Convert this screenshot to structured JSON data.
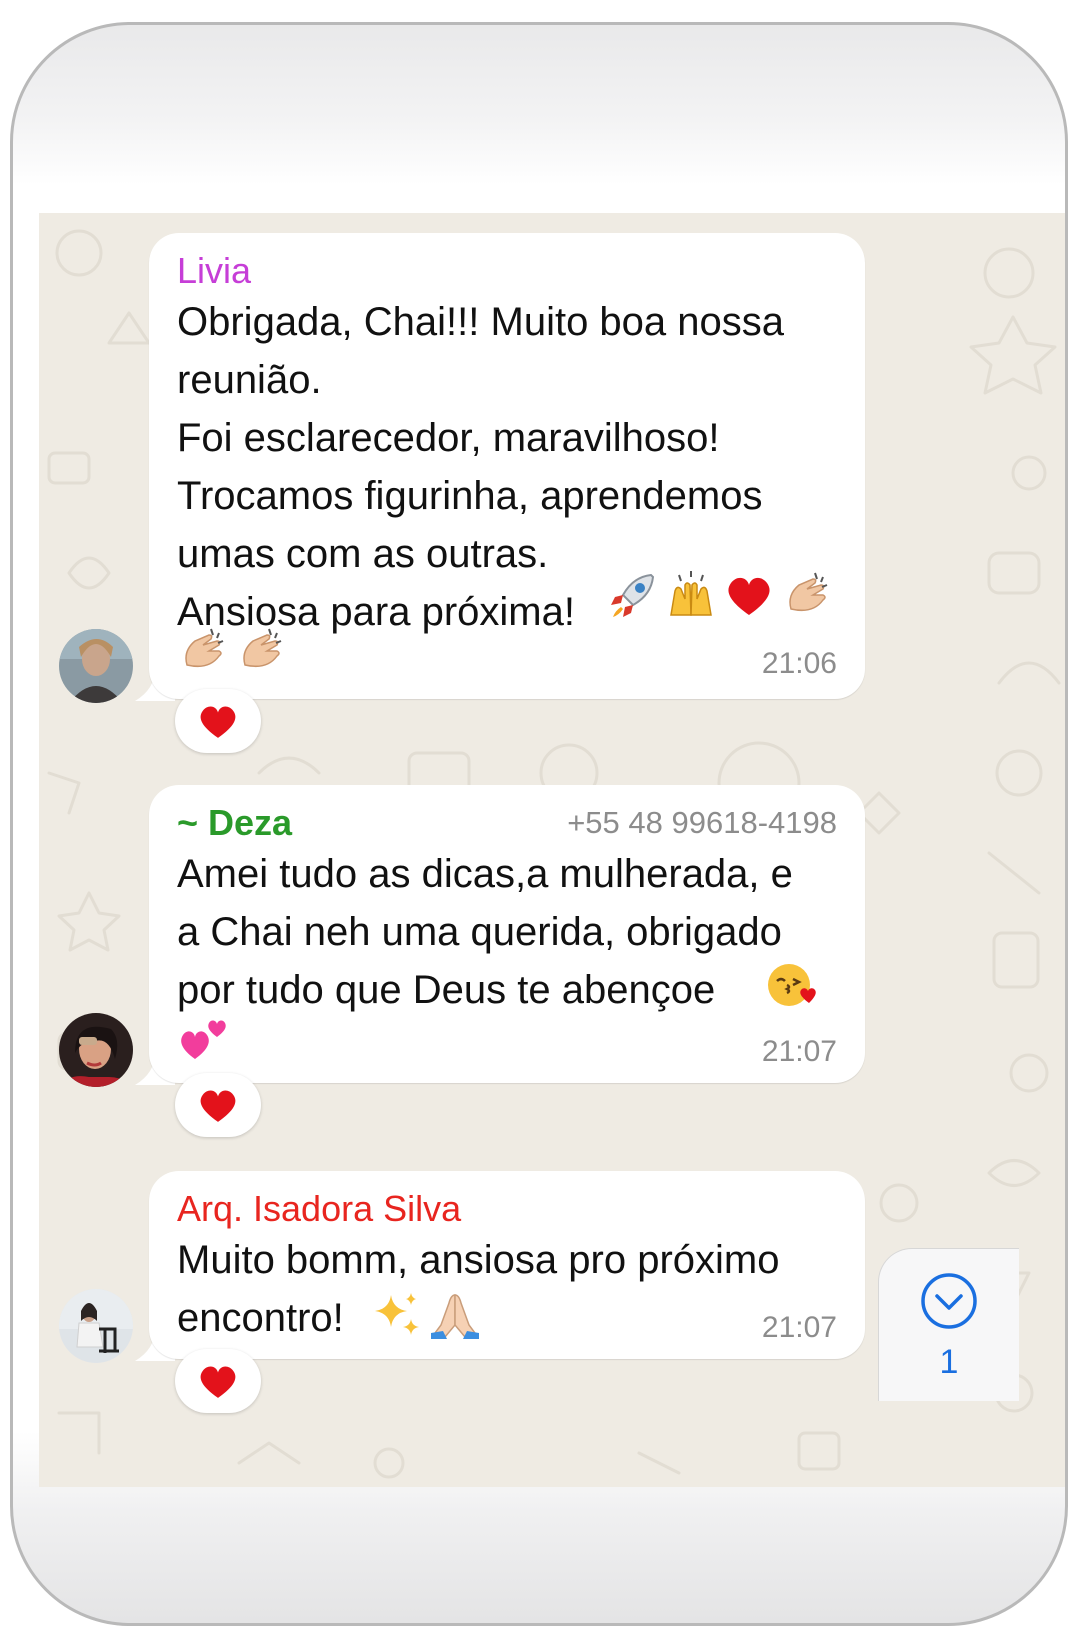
{
  "colors": {
    "chat_background": "#efebe3",
    "bubble": "#ffffff",
    "sender_livia": "#c63ed7",
    "sender_deza": "#2a9a2a",
    "sender_isadora": "#e8251f",
    "timestamp": "#8c8c8c",
    "scroll_accent": "#1a6fe0"
  },
  "messages": [
    {
      "sender": "Livia",
      "text": "Obrigada, Chai!!! Muito boa nossa\nreunião.\nFoi esclarecedor, maravilhoso!\nTrocamos figurinha, aprendemos\numas com as outras.\nAnsiosa para próxima!",
      "emojis": [
        "rocket-emoji",
        "raised-hands-emoji",
        "red-heart-emoji",
        "clapping-hands-emoji",
        "clapping-hands-emoji",
        "clapping-hands-emoji"
      ],
      "time": "21:06",
      "reaction": "red-heart-emoji"
    },
    {
      "sender": "~ Deza",
      "phone": "+55 48 99618-4198",
      "text": "Amei tudo as dicas,a mulherada, e\na Chai neh uma querida, obrigado\npor tudo que Deus te abençoe",
      "emojis": [
        "face-blowing-kiss-emoji",
        "two-hearts-emoji"
      ],
      "time": "21:07",
      "reaction": "red-heart-emoji"
    },
    {
      "sender": "Arq. Isadora Silva",
      "text": "Muito bomm, ansiosa pro próximo\nencontro!",
      "emojis": [
        "sparkles-emoji",
        "folded-hands-emoji"
      ],
      "time": "21:07",
      "reaction": "red-heart-emoji"
    }
  ],
  "scroll_to_bottom": {
    "icon": "chevron-down-circle-icon",
    "unread_count": "1"
  }
}
